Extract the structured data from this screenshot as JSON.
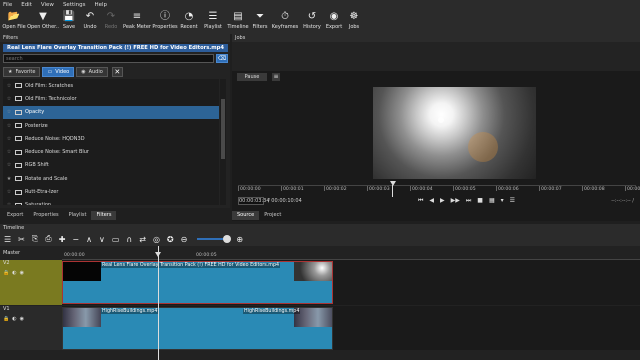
{
  "menu": [
    "File",
    "Edit",
    "View",
    "Settings",
    "Help"
  ],
  "toolbar": [
    {
      "label": "Open File",
      "icon": "open-file-icon",
      "glyph": "📂",
      "enabled": true
    },
    {
      "label": "Open Other..",
      "icon": "open-other-icon",
      "glyph": "▼",
      "enabled": true
    },
    {
      "label": "Save",
      "icon": "save-icon",
      "glyph": "💾",
      "enabled": true
    },
    {
      "label": "Undo",
      "icon": "undo-icon",
      "glyph": "↶",
      "enabled": true
    },
    {
      "label": "Redo",
      "icon": "redo-icon",
      "glyph": "↷",
      "enabled": false
    },
    {
      "label": "Peak Meter",
      "icon": "peak-meter-icon",
      "glyph": "≡",
      "enabled": true
    },
    {
      "label": "Properties",
      "icon": "properties-icon",
      "glyph": "ⓘ",
      "enabled": true
    },
    {
      "label": "Recent",
      "icon": "recent-icon",
      "glyph": "◔",
      "enabled": true
    },
    {
      "label": "Playlist",
      "icon": "playlist-icon",
      "glyph": "☰",
      "enabled": true
    },
    {
      "label": "Timeline",
      "icon": "timeline-icon",
      "glyph": "▤",
      "enabled": true
    },
    {
      "label": "Filters",
      "icon": "filters-icon",
      "glyph": "⏷",
      "enabled": true
    },
    {
      "label": "Keyframes",
      "icon": "keyframes-icon",
      "glyph": "⏱",
      "enabled": true
    },
    {
      "label": "History",
      "icon": "history-icon",
      "glyph": "↺",
      "enabled": true
    },
    {
      "label": "Export",
      "icon": "export-icon",
      "glyph": "◉",
      "enabled": true
    },
    {
      "label": "Jobs",
      "icon": "jobs-icon",
      "glyph": "☸",
      "enabled": true
    }
  ],
  "filters": {
    "panel_title": "Filters",
    "clip_title": "Real Lens Flare Overlay Transition Pack (!) FREE HD for Video Editors.mp4",
    "search_placeholder": "search",
    "categories": {
      "favorite": "Favorite",
      "video": "Video",
      "audio": "Audio"
    },
    "items": [
      {
        "label": "Old Film: Scratches",
        "selected": false,
        "fav": false
      },
      {
        "label": "Old Film: Technicolor",
        "selected": false,
        "fav": false
      },
      {
        "label": "Opacity",
        "selected": true,
        "fav": false
      },
      {
        "label": "Posterize",
        "selected": false,
        "fav": false
      },
      {
        "label": "Reduce Noise: HQDN3D",
        "selected": false,
        "fav": false
      },
      {
        "label": "Reduce Noise: Smart Blur",
        "selected": false,
        "fav": false
      },
      {
        "label": "RGB Shift",
        "selected": false,
        "fav": false
      },
      {
        "label": "Rotate and Scale",
        "selected": false,
        "fav": true
      },
      {
        "label": "Rutt-Etra-Izer",
        "selected": false,
        "fav": false
      },
      {
        "label": "Saturation",
        "selected": false,
        "fav": false
      }
    ],
    "tabs": [
      "Export",
      "Properties",
      "Playlist",
      "Filters"
    ]
  },
  "jobs": {
    "panel_title": "Jobs"
  },
  "player": {
    "pause_label": "Pause",
    "ruler": [
      "00:00:00",
      "00:00:01",
      "00:00:02",
      "00:00:03",
      "00:00:04",
      "00:00:05",
      "00:00:06",
      "00:00:07",
      "00:00:08",
      "00:00:0"
    ],
    "current_time": "00:00:03:34",
    "total_time": "/ 00:00:10:04",
    "out_time": "--:--:--:-- /",
    "transport": [
      "⏮",
      "◀",
      "▶",
      "▶▶",
      "⏭",
      "■",
      "▦",
      "▾",
      "☰"
    ],
    "tabs": [
      "Source",
      "Project"
    ]
  },
  "timeline": {
    "title": "Timeline",
    "ruler": [
      "00:00:00",
      "00:00:05"
    ],
    "tracks": {
      "master": "Master",
      "v2": "V2",
      "v1": "V1"
    },
    "clips_v2": [
      {
        "label": "Real Lens Flare Overlay Transition Pack (!) FREE HD for Video Editors.mp4"
      }
    ],
    "clips_v1": [
      {
        "label": "HighRiseBuildings.mp4"
      },
      {
        "label": "HighRiseBuildings.mp4"
      }
    ],
    "tools": [
      "☰",
      "✂",
      "⎘",
      "⎙",
      "✚",
      "−",
      "∧",
      "∨",
      "▭",
      "∩",
      "⇄",
      "◎",
      "✪",
      "⊖",
      "⊕"
    ]
  }
}
